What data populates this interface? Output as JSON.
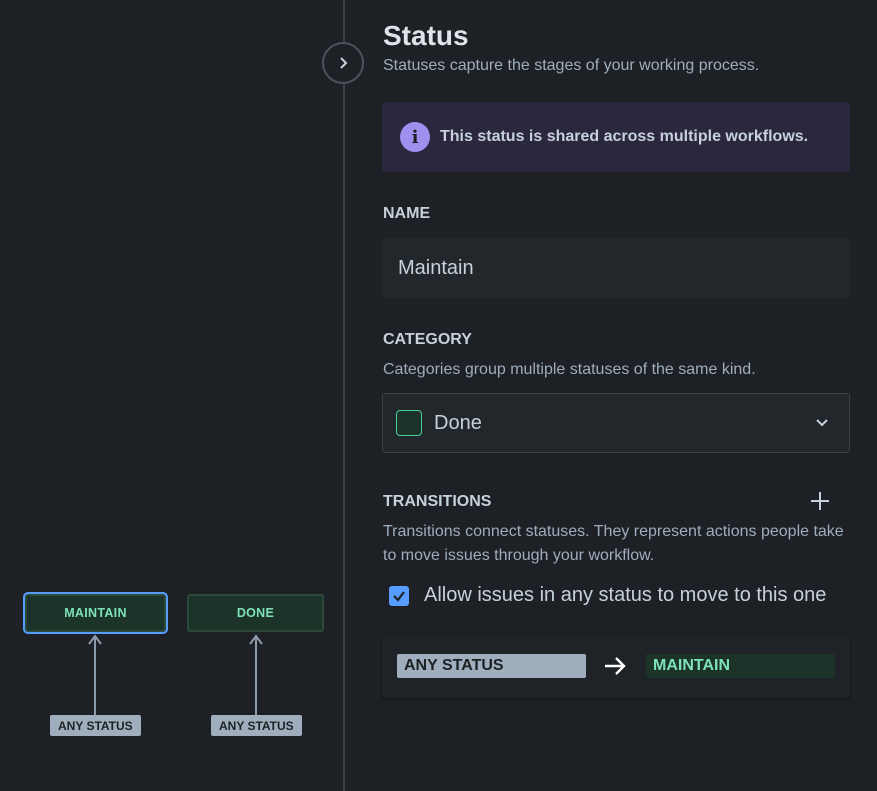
{
  "canvas": {
    "nodes": [
      {
        "label": "MAINTAIN"
      },
      {
        "label": "DONE"
      }
    ],
    "any_status_labels": [
      "ANY STATUS",
      "ANY STATUS"
    ]
  },
  "panel": {
    "title": "Status",
    "subtitle": "Statuses capture the stages of your working process.",
    "info_message": "This status is shared across multiple workflows.",
    "name": {
      "label": "NAME",
      "value": "Maintain"
    },
    "category": {
      "label": "CATEGORY",
      "description": "Categories group multiple statuses of the same kind.",
      "selected": "Done"
    },
    "transitions": {
      "label": "TRANSITIONS",
      "description_line1": "Transitions connect statuses. They represent actions people take",
      "description_line2": "to move issues through your workflow.",
      "allow_any_label": "Allow issues in any status to move to this one",
      "allow_any_checked": true,
      "items": [
        {
          "from": "ANY STATUS",
          "to": "MAINTAIN"
        }
      ]
    }
  },
  "colors": {
    "accent": "#579dff",
    "done_green": "#7ee2b8",
    "info_purple": "#9f8fef",
    "background": "#1d2125"
  },
  "icons": {
    "collapse": "chevron-right-icon",
    "info": "info-icon",
    "dropdown": "chevron-down-icon",
    "add": "plus-icon",
    "checkbox": "checkmark-icon",
    "transition": "arrow-right-icon"
  }
}
